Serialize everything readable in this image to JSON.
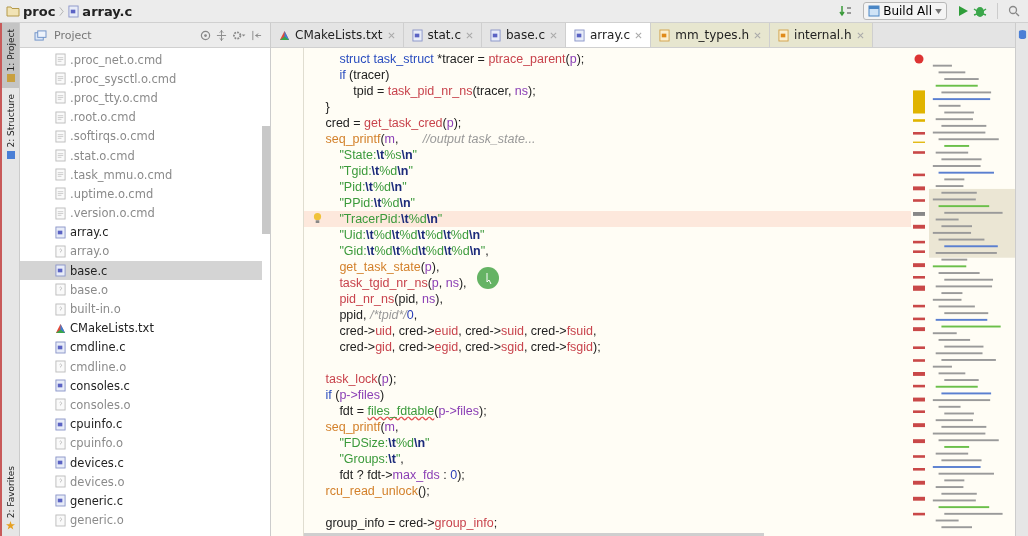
{
  "breadcrumbs": [
    {
      "label": "proc",
      "kind": "folder"
    },
    {
      "label": "array.c",
      "kind": "c"
    }
  ],
  "toolbar": {
    "run_config": "Build All"
  },
  "side_tabs": [
    {
      "label": "1: Project",
      "kind": "project",
      "selected": true
    },
    {
      "label": "2: Structure",
      "kind": "structure",
      "selected": false
    },
    {
      "label": "2: Favorites",
      "kind": "favorites",
      "selected": false
    }
  ],
  "project_panel": {
    "title": "Project",
    "items": [
      {
        "name": ".proc_net.o.cmd",
        "kind": "cmd",
        "selected": false
      },
      {
        "name": ".proc_sysctl.o.cmd",
        "kind": "cmd",
        "selected": false
      },
      {
        "name": ".proc_tty.o.cmd",
        "kind": "cmd",
        "selected": false
      },
      {
        "name": ".root.o.cmd",
        "kind": "cmd",
        "selected": false
      },
      {
        "name": ".softirqs.o.cmd",
        "kind": "cmd",
        "selected": false
      },
      {
        "name": ".stat.o.cmd",
        "kind": "cmd",
        "selected": false
      },
      {
        "name": ".task_mmu.o.cmd",
        "kind": "cmd",
        "selected": false
      },
      {
        "name": ".uptime.o.cmd",
        "kind": "cmd",
        "selected": false
      },
      {
        "name": ".version.o.cmd",
        "kind": "cmd",
        "selected": false
      },
      {
        "name": "array.c",
        "kind": "c",
        "selected": false
      },
      {
        "name": "array.o",
        "kind": "o",
        "selected": false
      },
      {
        "name": "base.c",
        "kind": "c",
        "selected": true
      },
      {
        "name": "base.o",
        "kind": "o",
        "selected": false
      },
      {
        "name": "built-in.o",
        "kind": "o",
        "selected": false
      },
      {
        "name": "CMakeLists.txt",
        "kind": "cmake",
        "selected": false
      },
      {
        "name": "cmdline.c",
        "kind": "c",
        "selected": false
      },
      {
        "name": "cmdline.o",
        "kind": "o",
        "selected": false
      },
      {
        "name": "consoles.c",
        "kind": "c",
        "selected": false
      },
      {
        "name": "consoles.o",
        "kind": "o",
        "selected": false
      },
      {
        "name": "cpuinfo.c",
        "kind": "c",
        "selected": false
      },
      {
        "name": "cpuinfo.o",
        "kind": "o",
        "selected": false
      },
      {
        "name": "devices.c",
        "kind": "c",
        "selected": false
      },
      {
        "name": "devices.o",
        "kind": "o",
        "selected": false
      },
      {
        "name": "generic.c",
        "kind": "c",
        "selected": false
      },
      {
        "name": "generic.o",
        "kind": "o",
        "selected": false
      }
    ]
  },
  "tabs": [
    {
      "label": "CMakeLists.txt",
      "kind": "cmake",
      "selected": false
    },
    {
      "label": "stat.c",
      "kind": "c",
      "selected": false
    },
    {
      "label": "base.c",
      "kind": "c",
      "selected": false
    },
    {
      "label": "array.c",
      "kind": "c",
      "selected": true
    },
    {
      "label": "mm_types.h",
      "kind": "h",
      "selected": false
    },
    {
      "label": "internal.h",
      "kind": "h",
      "selected": false
    }
  ],
  "code_blocks": [
    [
      {
        "highlighted": false,
        "tokens": [
          {
            "text": "    struct task_struct",
            "kind": "keyword"
          },
          {
            "text": " *tracer = ",
            "kind": "plain"
          },
          {
            "text": "ptrace_parent",
            "kind": "function"
          },
          {
            "text": "(",
            "kind": "plain"
          },
          {
            "text": "p",
            "kind": "variable"
          },
          {
            "text": ");",
            "kind": "plain"
          }
        ]
      },
      {
        "highlighted": false,
        "tokens": [
          {
            "text": "    if",
            "kind": "keyword"
          },
          {
            "text": " (tracer)",
            "kind": "plain"
          }
        ]
      },
      {
        "highlighted": false,
        "tokens": [
          {
            "text": "        tpid = ",
            "kind": "plain"
          },
          {
            "text": "task_pid_nr_ns",
            "kind": "function"
          },
          {
            "text": "(tracer, ",
            "kind": "plain"
          },
          {
            "text": "ns",
            "kind": "variable"
          },
          {
            "text": ");",
            "kind": "plain"
          }
        ]
      },
      {
        "highlighted": false,
        "tokens": [
          {
            "text": "}",
            "kind": "plain"
          }
        ]
      },
      {
        "highlighted": false,
        "tokens": [
          {
            "text": "cred = ",
            "kind": "plain"
          },
          {
            "text": "get_task_cred",
            "kind": "function"
          },
          {
            "text": "(",
            "kind": "plain"
          },
          {
            "text": "p",
            "kind": "variable"
          },
          {
            "text": ");",
            "kind": "plain"
          }
        ]
      },
      {
        "highlighted": false,
        "tokens": [
          {
            "text": "seq_printf",
            "kind": "call"
          },
          {
            "text": "(",
            "kind": "plain"
          },
          {
            "text": "m",
            "kind": "variable"
          },
          {
            "text": ",       ",
            "kind": "plain"
          },
          {
            "text": "//output task_state...",
            "kind": "comment"
          }
        ]
      },
      {
        "highlighted": false,
        "tokens": [
          {
            "text": "    \"State:",
            "kind": "string"
          },
          {
            "text": "\\t",
            "kind": "escape"
          },
          {
            "text": "%s",
            "kind": "string"
          },
          {
            "text": "\\n",
            "kind": "escape"
          },
          {
            "text": "\"",
            "kind": "string"
          }
        ]
      },
      {
        "highlighted": false,
        "tokens": [
          {
            "text": "    \"Tgid:",
            "kind": "string"
          },
          {
            "text": "\\t",
            "kind": "escape"
          },
          {
            "text": "%d",
            "kind": "string"
          },
          {
            "text": "\\n",
            "kind": "escape"
          },
          {
            "text": "\"",
            "kind": "string"
          }
        ]
      },
      {
        "highlighted": false,
        "tokens": [
          {
            "text": "    \"Pid:",
            "kind": "string"
          },
          {
            "text": "\\t",
            "kind": "escape"
          },
          {
            "text": "%d",
            "kind": "string"
          },
          {
            "text": "\\n",
            "kind": "escape"
          },
          {
            "text": "\"",
            "kind": "string"
          }
        ]
      },
      {
        "highlighted": false,
        "tokens": [
          {
            "text": "    \"PPid:",
            "kind": "string"
          },
          {
            "text": "\\t",
            "kind": "escape"
          },
          {
            "text": "%d",
            "kind": "string"
          },
          {
            "text": "\\n",
            "kind": "escape"
          },
          {
            "text": "\"",
            "kind": "string"
          }
        ]
      },
      {
        "highlighted": true,
        "tokens": [
          {
            "text": "    \"TracerPid:",
            "kind": "string"
          },
          {
            "text": "\\t",
            "kind": "escape"
          },
          {
            "text": "%d",
            "kind": "string"
          },
          {
            "text": "\\n",
            "kind": "escape"
          },
          {
            "text": "\"",
            "kind": "string"
          }
        ]
      },
      {
        "highlighted": false,
        "tokens": [
          {
            "text": "    \"Uid:",
            "kind": "string"
          },
          {
            "text": "\\t",
            "kind": "escape"
          },
          {
            "text": "%d",
            "kind": "string"
          },
          {
            "text": "\\t",
            "kind": "escape"
          },
          {
            "text": "%d",
            "kind": "string"
          },
          {
            "text": "\\t",
            "kind": "escape"
          },
          {
            "text": "%d",
            "kind": "string"
          },
          {
            "text": "\\t",
            "kind": "escape"
          },
          {
            "text": "%d",
            "kind": "string"
          },
          {
            "text": "\\n",
            "kind": "escape"
          },
          {
            "text": "\"",
            "kind": "string"
          }
        ]
      },
      {
        "highlighted": false,
        "tokens": [
          {
            "text": "    \"Gid:",
            "kind": "string"
          },
          {
            "text": "\\t",
            "kind": "escape"
          },
          {
            "text": "%d",
            "kind": "string"
          },
          {
            "text": "\\t",
            "kind": "escape"
          },
          {
            "text": "%d",
            "kind": "string"
          },
          {
            "text": "\\t",
            "kind": "escape"
          },
          {
            "text": "%d",
            "kind": "string"
          },
          {
            "text": "\\t",
            "kind": "escape"
          },
          {
            "text": "%d",
            "kind": "string"
          },
          {
            "text": "\\n",
            "kind": "escape"
          },
          {
            "text": "\"",
            "kind": "string"
          },
          {
            "text": ",",
            "kind": "plain"
          }
        ]
      },
      {
        "highlighted": false,
        "tokens": [
          {
            "text": "    get_task_state",
            "kind": "call"
          },
          {
            "text": "(",
            "kind": "plain"
          },
          {
            "text": "p",
            "kind": "variable"
          },
          {
            "text": "),",
            "kind": "plain"
          }
        ]
      },
      {
        "highlighted": false,
        "tokens": [
          {
            "text": "    task_tgid_nr_ns",
            "kind": "function"
          },
          {
            "text": "(",
            "kind": "plain"
          },
          {
            "text": "p",
            "kind": "variable"
          },
          {
            "text": ", ",
            "kind": "plain"
          },
          {
            "text": "ns",
            "kind": "variable"
          },
          {
            "text": "),",
            "kind": "plain"
          }
        ]
      },
      {
        "highlighted": false,
        "tokens": [
          {
            "text": "    pid_nr_ns",
            "kind": "function"
          },
          {
            "text": "(pid, ",
            "kind": "plain"
          },
          {
            "text": "ns",
            "kind": "variable"
          },
          {
            "text": "),",
            "kind": "plain"
          }
        ]
      },
      {
        "highlighted": false,
        "tokens": [
          {
            "text": "    ppid, ",
            "kind": "plain"
          },
          {
            "text": "/*tpid*/",
            "kind": "comment"
          },
          {
            "text": "0",
            "kind": "number"
          },
          {
            "text": ",",
            "kind": "plain"
          }
        ]
      },
      {
        "highlighted": false,
        "tokens": [
          {
            "text": "    cred->",
            "kind": "plain"
          },
          {
            "text": "uid",
            "kind": "function"
          },
          {
            "text": ", cred->",
            "kind": "plain"
          },
          {
            "text": "euid",
            "kind": "function"
          },
          {
            "text": ", cred->",
            "kind": "plain"
          },
          {
            "text": "suid",
            "kind": "function"
          },
          {
            "text": ", cred->",
            "kind": "plain"
          },
          {
            "text": "fsuid",
            "kind": "function"
          },
          {
            "text": ",",
            "kind": "plain"
          }
        ]
      },
      {
        "highlighted": false,
        "tokens": [
          {
            "text": "    cred->",
            "kind": "plain"
          },
          {
            "text": "gid",
            "kind": "function"
          },
          {
            "text": ", cred->",
            "kind": "plain"
          },
          {
            "text": "egid",
            "kind": "function"
          },
          {
            "text": ", cred->",
            "kind": "plain"
          },
          {
            "text": "sgid",
            "kind": "function"
          },
          {
            "text": ", cred->",
            "kind": "plain"
          },
          {
            "text": "fsgid",
            "kind": "function"
          },
          {
            "text": ");",
            "kind": "plain"
          }
        ]
      }
    ],
    [
      {
        "highlighted": false,
        "tokens": [
          {
            "text": "task_lock",
            "kind": "function"
          },
          {
            "text": "(",
            "kind": "plain"
          },
          {
            "text": "p",
            "kind": "variable"
          },
          {
            "text": ");",
            "kind": "plain"
          }
        ]
      },
      {
        "highlighted": false,
        "tokens": [
          {
            "text": "if",
            "kind": "keyword"
          },
          {
            "text": " (",
            "kind": "plain"
          },
          {
            "text": "p->files",
            "kind": "variable"
          },
          {
            "text": ")",
            "kind": "plain"
          }
        ]
      },
      {
        "highlighted": false,
        "tokens": [
          {
            "text": "    fdt = ",
            "kind": "plain"
          },
          {
            "text": "files_fdtable",
            "kind": "warning"
          },
          {
            "text": "(",
            "kind": "plain"
          },
          {
            "text": "p->files",
            "kind": "variable"
          },
          {
            "text": ");",
            "kind": "plain"
          }
        ]
      },
      {
        "highlighted": false,
        "tokens": [
          {
            "text": "seq_printf",
            "kind": "call"
          },
          {
            "text": "(",
            "kind": "plain"
          },
          {
            "text": "m",
            "kind": "variable"
          },
          {
            "text": ",",
            "kind": "plain"
          }
        ]
      },
      {
        "highlighted": false,
        "tokens": [
          {
            "text": "    \"FDSize:",
            "kind": "string"
          },
          {
            "text": "\\t",
            "kind": "escape"
          },
          {
            "text": "%d",
            "kind": "string"
          },
          {
            "text": "\\n",
            "kind": "escape"
          },
          {
            "text": "\"",
            "kind": "string"
          }
        ]
      },
      {
        "highlighted": false,
        "tokens": [
          {
            "text": "    \"Groups:",
            "kind": "string"
          },
          {
            "text": "\\t",
            "kind": "escape"
          },
          {
            "text": "\"",
            "kind": "string"
          },
          {
            "text": ",",
            "kind": "plain"
          }
        ]
      },
      {
        "highlighted": false,
        "tokens": [
          {
            "text": "    fdt ? fdt->",
            "kind": "plain"
          },
          {
            "text": "max_fds",
            "kind": "variable"
          },
          {
            "text": " : ",
            "kind": "plain"
          },
          {
            "text": "0",
            "kind": "number"
          },
          {
            "text": ");",
            "kind": "plain"
          }
        ]
      },
      {
        "highlighted": false,
        "tokens": [
          {
            "text": "rcu_read_unlock",
            "kind": "call"
          },
          {
            "text": "();",
            "kind": "plain"
          }
        ]
      }
    ],
    [
      {
        "highlighted": false,
        "tokens": [
          {
            "text": "group_info = cred->",
            "kind": "plain"
          },
          {
            "text": "group_info",
            "kind": "function"
          },
          {
            "text": ";",
            "kind": "plain"
          }
        ]
      }
    ]
  ]
}
